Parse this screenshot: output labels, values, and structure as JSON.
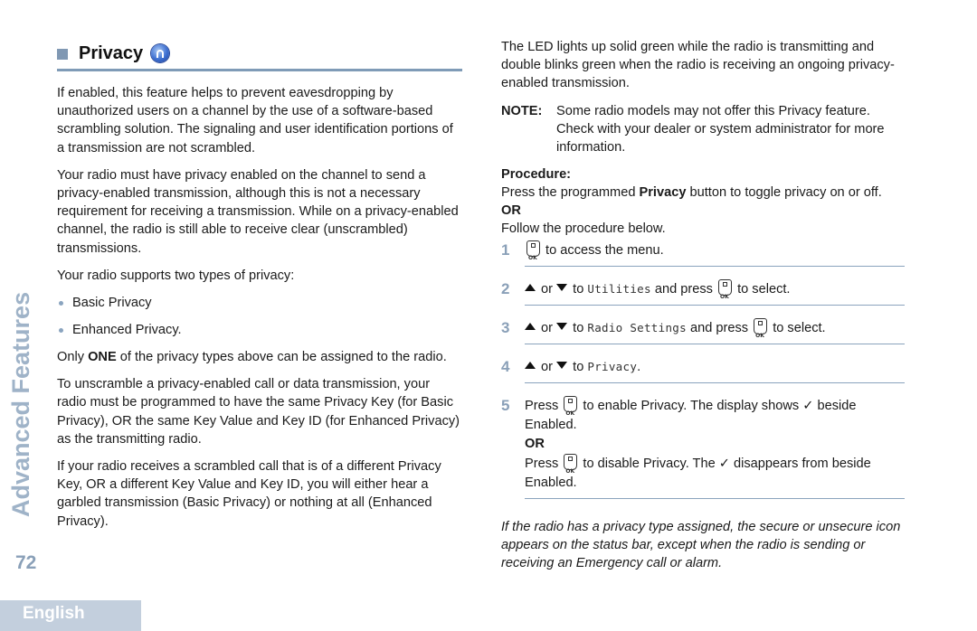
{
  "side_title": "Advanced Features",
  "page_number": "72",
  "language_tab": "English",
  "section": {
    "title": "Privacy",
    "icon": "privacy-feature-icon"
  },
  "left": {
    "para1": "If enabled, this feature helps to prevent eavesdropping by unauthorized users on a channel by the use of a software-based scrambling solution. The signaling and user identification portions of a transmission are not scrambled.",
    "para2": "Your radio must have privacy enabled on the channel to send a privacy-enabled transmission, although this is not a necessary requirement for receiving a transmission. While on a privacy-enabled channel, the radio is still able to receive clear (unscrambled) transmissions.",
    "para3": "Your radio supports two types of privacy:",
    "bullets": [
      "Basic Privacy",
      "Enhanced Privacy."
    ],
    "para4_pre": "Only ",
    "para4_bold": "ONE",
    "para4_post": " of the privacy types above can be assigned to the radio.",
    "para5": "To unscramble a privacy-enabled call or data transmission, your radio must be programmed to have the same Privacy Key (for Basic Privacy), OR the same Key Value and Key ID (for Enhanced Privacy) as the transmitting radio.",
    "para6": "If your radio receives a scrambled call that is of a different Privacy Key, OR a different Key Value and Key ID, you will either hear a garbled transmission (Basic Privacy) or nothing at all (Enhanced Privacy)."
  },
  "right": {
    "para1": "The LED lights up solid green while the radio is transmitting and double blinks green when the radio is receiving an ongoing privacy-enabled transmission.",
    "note_label": "NOTE:",
    "note_text": "Some radio models may not offer this Privacy feature. Check with your dealer or system administrator for more information.",
    "procedure_label": "Procedure:",
    "proc_pre": "Press the programmed ",
    "proc_bold": "Privacy",
    "proc_post": " button to toggle privacy on or off.",
    "or": "OR",
    "follow": "Follow the procedure below.",
    "steps": [
      {
        "num": "1",
        "text": " to access the menu."
      },
      {
        "num": "2",
        "or": " or ",
        "to": " to ",
        "menu": "Utilities",
        "press": " and press ",
        "end": " to select."
      },
      {
        "num": "3",
        "or": " or ",
        "to": " to ",
        "menu": "Radio Settings",
        "press": " and press ",
        "end": " to select."
      },
      {
        "num": "4",
        "or": " or ",
        "to": " to ",
        "menu": "Privacy",
        "end": "."
      },
      {
        "num": "5",
        "a_pre": "Press ",
        "a_post": " to enable Privacy. The display shows ✓ beside Enabled.",
        "or": "OR",
        "b_pre": "Press ",
        "b_post": " to disable Privacy. The ✓ disappears from beside Enabled."
      }
    ],
    "footnote": "If the radio has a privacy type assigned, the secure or unsecure icon appears on the status bar, except when the radio is sending or receiving an Emergency call or alarm."
  }
}
